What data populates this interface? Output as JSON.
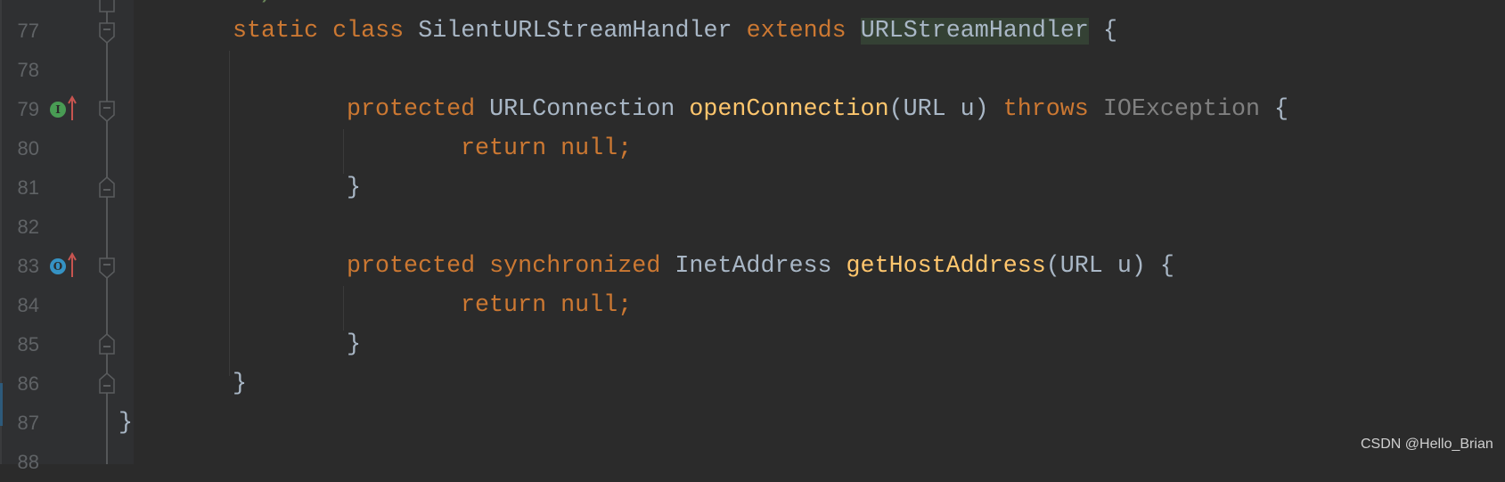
{
  "colors": {
    "keyword": "#cc7832",
    "class": "#a9b7c6",
    "method": "#ffc66d",
    "exception": "#808080",
    "highlight": "#344134",
    "line_number": "#606366",
    "background": "#2b2b2b"
  },
  "line_numbers": [
    "77",
    "78",
    "79",
    "80",
    "81",
    "82",
    "83",
    "84",
    "85",
    "86",
    "87",
    "88"
  ],
  "code": {
    "l76": {
      "tail": ")"
    },
    "l77": {
      "static": "static",
      "class": "class",
      "name": "SilentURLStreamHandler",
      "extends": "extends",
      "parent": "URLStreamHandler",
      "brace": "{"
    },
    "l79": {
      "protected": "protected",
      "type": "URLConnection",
      "method": "openConnection",
      "params": "(URL u)",
      "throws": "throws",
      "exception": "IOException",
      "brace": "{"
    },
    "l80": {
      "return": "return null;"
    },
    "l81": {
      "brace": "}"
    },
    "l83": {
      "protected": "protected",
      "synchronized": "synchronized",
      "type": "InetAddress",
      "method": "getHostAddress",
      "params": "(URL u)",
      "brace": "{"
    },
    "l84": {
      "return": "return null;"
    },
    "l85": {
      "brace": "}"
    },
    "l86": {
      "brace": "}"
    },
    "l87": {
      "brace": "}"
    }
  },
  "gutter_icons": {
    "l79": "implements-method-icon",
    "l79_label": "I",
    "l83": "overrides-method-icon",
    "l83_label": "O"
  },
  "watermark": "CSDN @Hello_Brian"
}
